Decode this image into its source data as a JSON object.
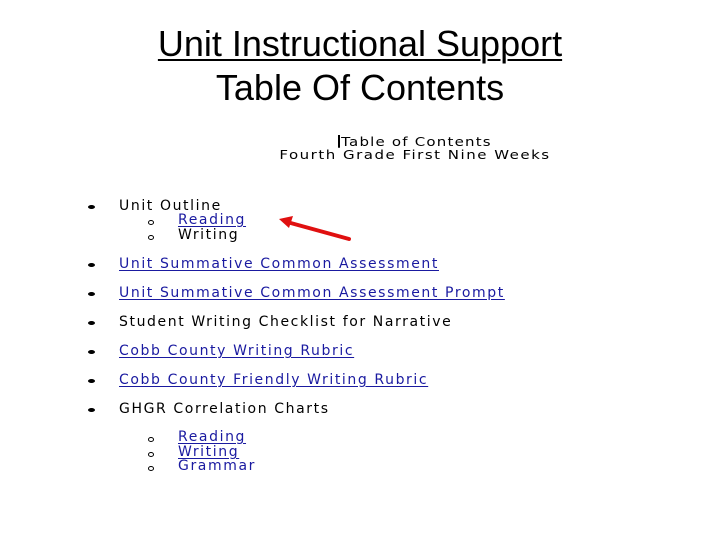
{
  "slide": {
    "title_line1": "Unit Instructional Support",
    "title_line2": "Table Of Contents"
  },
  "document": {
    "heading_line1": "Table of Contents",
    "heading_line2": "Fourth Grade First Nine Weeks",
    "items": [
      {
        "label": "Unit Outline",
        "is_link": false,
        "children": [
          {
            "label": "Reading",
            "is_link": true
          },
          {
            "label": "Writing",
            "is_link": false
          }
        ]
      },
      {
        "label": "Unit Summative Common Assessment",
        "is_link": true
      },
      {
        "label": "Unit Summative Common Assessment Prompt",
        "is_link": true
      },
      {
        "label": "Student Writing Checklist for Narrative",
        "is_link": false
      },
      {
        "label": "Cobb County Writing Rubric",
        "is_link": true
      },
      {
        "label": "Cobb County Friendly Writing Rubric",
        "is_link": true
      },
      {
        "label": "GHGR Correlation Charts",
        "is_link": false,
        "children": [
          {
            "label": "Reading",
            "is_link": true
          },
          {
            "label": "Writing",
            "is_link": true
          },
          {
            "label": "Grammar",
            "is_link": false
          }
        ]
      }
    ]
  },
  "annotation": {
    "arrow_color": "#e01010",
    "points_to": "Reading"
  },
  "colors": {
    "link": "#1a1aa0",
    "text": "#000000",
    "background": "#ffffff"
  }
}
